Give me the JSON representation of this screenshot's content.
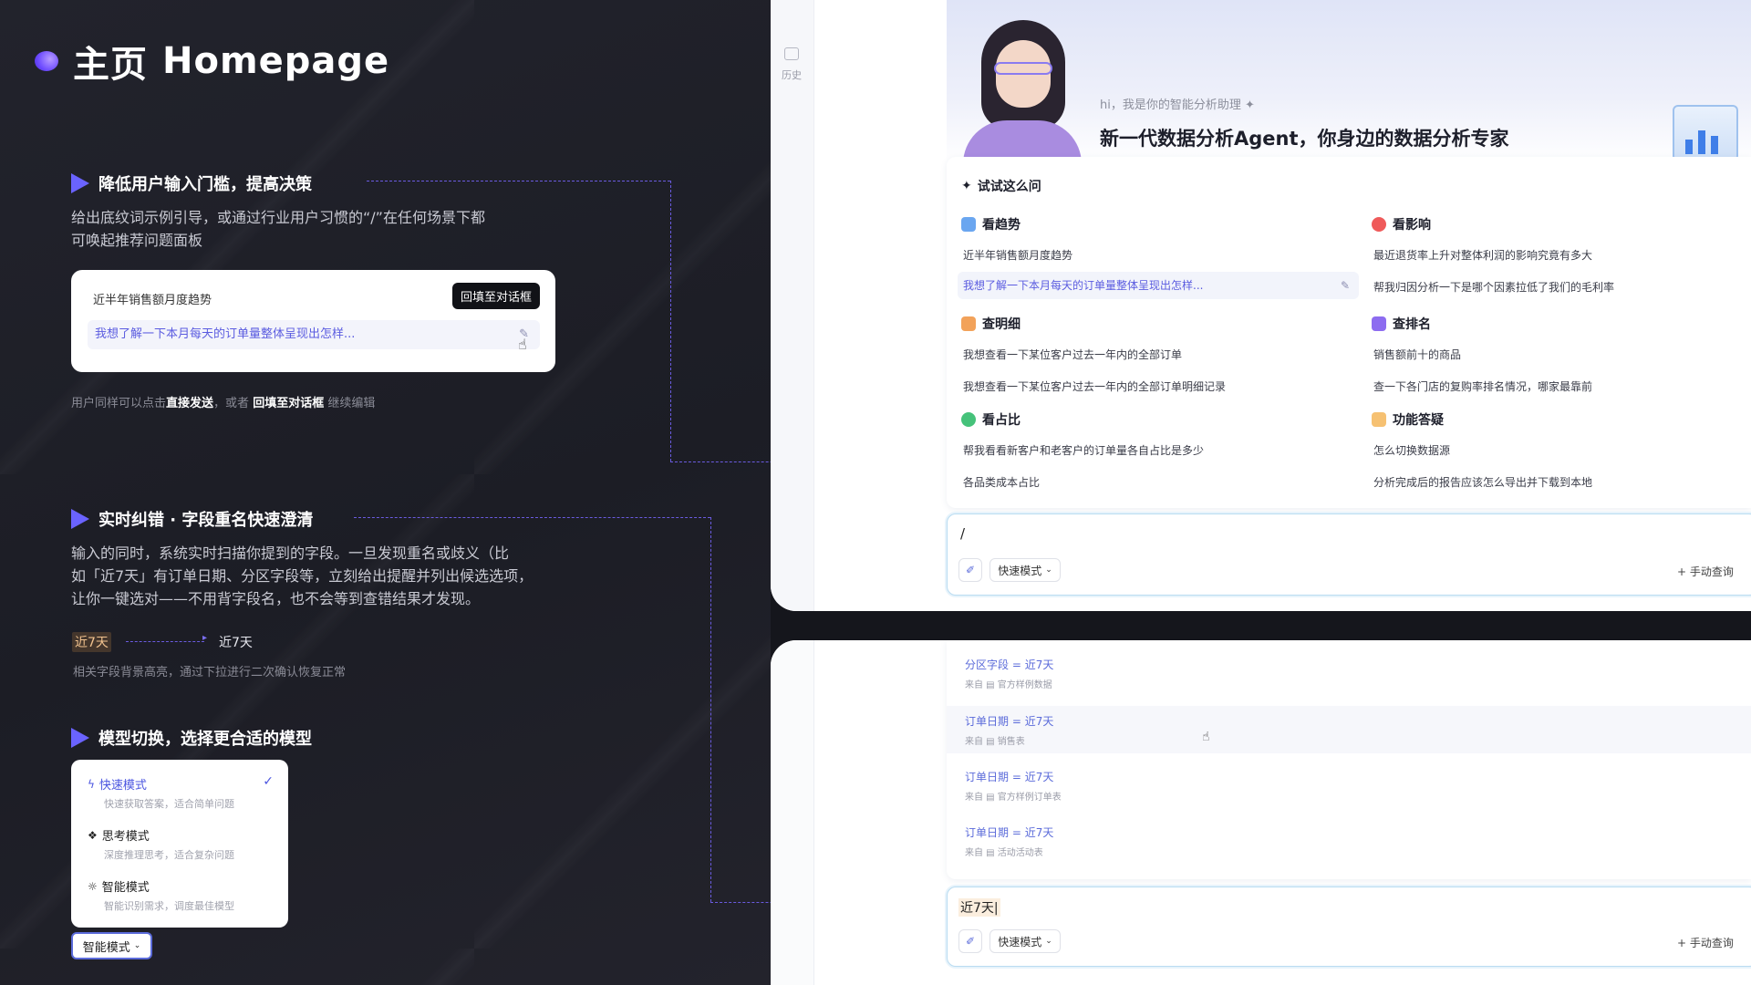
{
  "title": {
    "zh": "主页",
    "en": "Homepage"
  },
  "section1": {
    "title": "降低用户输入门槛，提高决策",
    "desc_line1": "给出底纹词示例引导，或通过行业用户习惯的“/”在任何场景下都",
    "desc_line2": "可唤起推荐问题面板",
    "card": {
      "item1": "近半年销售额月度趋势",
      "item2": "我想了解一下本月每天的订单量整体呈现出怎样...",
      "tooltip": "回填至对话框"
    },
    "note": {
      "p1": "用户同样可以点击",
      "b1": "直接发送",
      "p2": "，或者",
      "b2": "回填至对话框",
      "p3": "继续编辑"
    }
  },
  "section2": {
    "title": "实时纠错 · 字段重名快速澄清",
    "desc_line1": "输入的同时，系统实时扫描你提到的字段。一旦发现重名或歧义（比",
    "desc_line2": "如「近7天」有订单日期、分区字段等，立刻给出提醒并列出候选选项，",
    "desc_line3": "让你一键选对——不用背字段名，也不会等到查错结果才发现。",
    "tag_before": "近7天",
    "tag_after": "近7天",
    "note": "相关字段背景高亮，通过下拉进行二次确认恢复正常"
  },
  "section3": {
    "title": "模型切换，选择更合适的模型",
    "modes": [
      {
        "name": "快速模式",
        "desc": "快速获取答案，适合简单问题"
      },
      {
        "name": "思考模式",
        "desc": "深度推理思考，适合复杂问题"
      },
      {
        "name": "智能模式",
        "desc": "智能识别需求，调度最佳模型"
      }
    ],
    "selected_label": "智能模式"
  },
  "screen1": {
    "sidebar_history": "历史",
    "greeting_small": "hi，我是你的智能分析助理",
    "greeting_big": "新一代数据分析Agent，你身边的数据分析专家",
    "try_title": "试试这么问",
    "categories": [
      {
        "title": "看趋势",
        "q1": "近半年销售额月度趋势",
        "q2": "我想了解一下本月每天的订单量整体呈现出怎样..."
      },
      {
        "title": "看影响",
        "q1": "最近退货率上升对整体利润的影响究竟有多大",
        "q2": "帮我归因分析一下是哪个因素拉低了我们的毛利率"
      },
      {
        "title": "查明细",
        "q1": "我想查看一下某位客户过去一年内的全部订单",
        "q2": "我想查看一下某位客户过去一年内的全部订单明细记录"
      },
      {
        "title": "查排名",
        "q1": "销售额前十的商品",
        "q2": "查一下各门店的复购率排名情况，哪家最靠前"
      },
      {
        "title": "看占比",
        "q1": "帮我看看新客户和老客户的订单量各自占比是多少",
        "q2": "各品类成本占比"
      },
      {
        "title": "功能答疑",
        "q1": "怎么切换数据源",
        "q2": "分析完成后的报告应该怎么导出并下载到本地"
      }
    ],
    "input_value": "/",
    "mode_label": "快速模式",
    "manual_query": "+ 手动查询"
  },
  "screen2": {
    "candidates": [
      {
        "field": "分区字段",
        "value": "近7天",
        "source": "来自 ▤ 官方样例数据"
      },
      {
        "field": "订单日期",
        "value": "近7天",
        "source": "来自 ▤ 销售表"
      },
      {
        "field": "订单日期",
        "value": "近7天",
        "source": "来自 ▤ 官方样例订单表"
      },
      {
        "field": "订单日期",
        "value": "近7天",
        "source": "来自 ▤ 活动活动表"
      }
    ],
    "input_value": "近7天|",
    "mode_label": "快速模式",
    "manual_query": "+ 手动查询"
  },
  "colors": {
    "accent": "#6a63ff",
    "link": "#5b5ce0",
    "bg": "#1d1e26"
  }
}
